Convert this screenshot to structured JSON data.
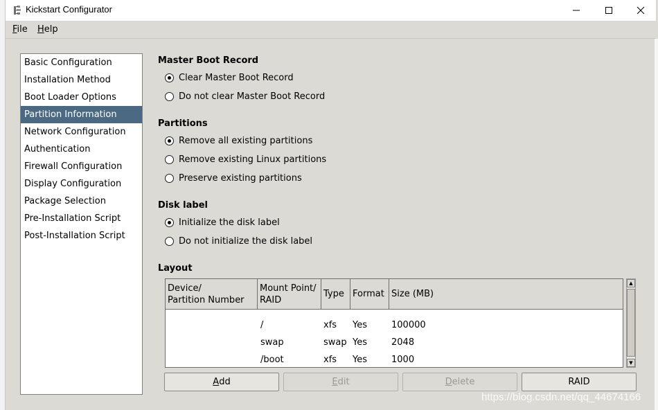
{
  "window": {
    "title": "Kickstart Configurator"
  },
  "menu": {
    "file": {
      "label_first": "F",
      "label_rest": "ile"
    },
    "help": {
      "label_first": "H",
      "label_rest": "elp"
    }
  },
  "sidebar": {
    "selected_index": 3,
    "items": [
      "Basic Configuration",
      "Installation Method",
      "Boot Loader Options",
      "Partition Information",
      "Network Configuration",
      "Authentication",
      "Firewall Configuration",
      "Display Configuration",
      "Package Selection",
      "Pre-Installation Script",
      "Post-Installation Script"
    ]
  },
  "mbr": {
    "title": "Master Boot Record",
    "options": [
      "Clear Master Boot Record",
      "Do not clear Master Boot Record"
    ],
    "selected": 0
  },
  "partitions": {
    "title": "Partitions",
    "options": [
      "Remove all existing partitions",
      "Remove existing Linux partitions",
      "Preserve existing partitions"
    ],
    "selected": 0
  },
  "disklabel": {
    "title": "Disk label",
    "options": [
      "Initialize the disk label",
      "Do not initialize the disk label"
    ],
    "selected": 0
  },
  "layout": {
    "title": "Layout",
    "columns": {
      "device_line1": "Device/",
      "device_line2": "Partition Number",
      "mount_line1": "Mount Point/",
      "mount_line2": "RAID",
      "type": "Type",
      "format": "Format",
      "size": "Size (MB)"
    },
    "rows": [
      {
        "device": "",
        "mount": "/",
        "type": "xfs",
        "format": "Yes",
        "size": "100000"
      },
      {
        "device": "",
        "mount": "swap",
        "type": "swap",
        "format": "Yes",
        "size": "2048"
      },
      {
        "device": "",
        "mount": "/boot",
        "type": "xfs",
        "format": "Yes",
        "size": "1000"
      }
    ]
  },
  "buttons": {
    "add": {
      "first": "A",
      "rest": "dd"
    },
    "edit": {
      "first": "E",
      "rest": "dit"
    },
    "delete": {
      "first": "D",
      "rest": "elete"
    },
    "raid": "RAID"
  },
  "icons": {
    "app": "kickstart-app-icon",
    "minimize": "minimize-icon",
    "maximize": "maximize-icon",
    "close": "close-icon"
  },
  "watermark": "https://blog.csdn.net/qq_44674166"
}
